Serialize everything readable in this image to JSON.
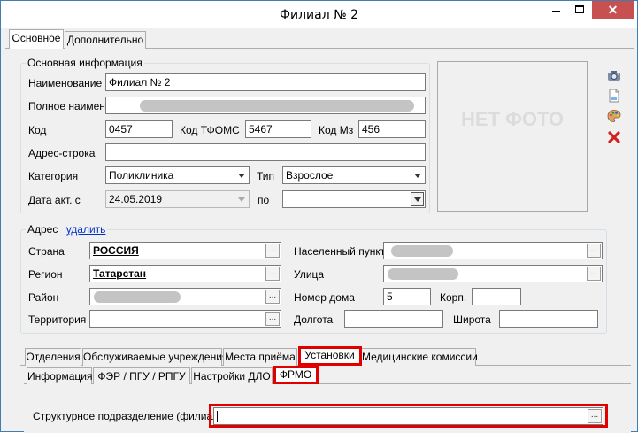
{
  "window": {
    "title": "Филиал № 2"
  },
  "top_tabs": [
    {
      "label": "Основное"
    },
    {
      "label": "Дополнительно"
    }
  ],
  "main_info": {
    "title": "Основная информация",
    "name_label": "Наименование",
    "name_value": "Филиал № 2",
    "fullname_label": "Полное наимен.",
    "code_label": "Код",
    "code_value": "0457",
    "tfoms_label": "Код ТФОМС",
    "tfoms_value": "5467",
    "mz_label": "Код Мз",
    "mz_value": "456",
    "address_line_label": "Адрес-строка",
    "category_label": "Категория",
    "category_value": "Поликлиника",
    "type_label": "Тип",
    "type_value": "Взрослое",
    "date_label": "Дата акт. с",
    "date_value": "24.05.2019",
    "to_label": "по"
  },
  "photo": {
    "placeholder": "НЕТ ФОТО"
  },
  "side_icons": [
    "camera-icon",
    "document-icon",
    "palette-icon",
    "delete-x-icon"
  ],
  "address": {
    "title": "Адрес",
    "delete_link": "удалить",
    "country_label": "Страна",
    "country_value": "РОССИЯ",
    "region_label": "Регион",
    "region_value": "Татарстан",
    "district_label": "Район",
    "territory_label": "Территория",
    "settlement_label": "Населенный пункт",
    "street_label": "Улица",
    "house_label": "Номер дома",
    "house_value": "5",
    "building_label": "Корп.",
    "longitude_label": "Долгота",
    "latitude_label": "Широта",
    "ellipsis": "..."
  },
  "bottom_tabs": [
    {
      "label": "Отделения"
    },
    {
      "label": "Обслуживаемые учреждения"
    },
    {
      "label": "Места приёма"
    },
    {
      "label": "Установки"
    },
    {
      "label": "Медицинские комиссии"
    }
  ],
  "sub_tabs": [
    {
      "label": "Информация"
    },
    {
      "label": "ФЭР / ПГУ / РПГУ"
    },
    {
      "label": "Настройки ДЛО"
    },
    {
      "label": "ФРМО"
    }
  ],
  "frmo": {
    "struct_label": "Структурное подразделение (филиал)",
    "struct_value": ""
  },
  "colors": {
    "highlight": "#e00000",
    "link": "#0033cc"
  }
}
